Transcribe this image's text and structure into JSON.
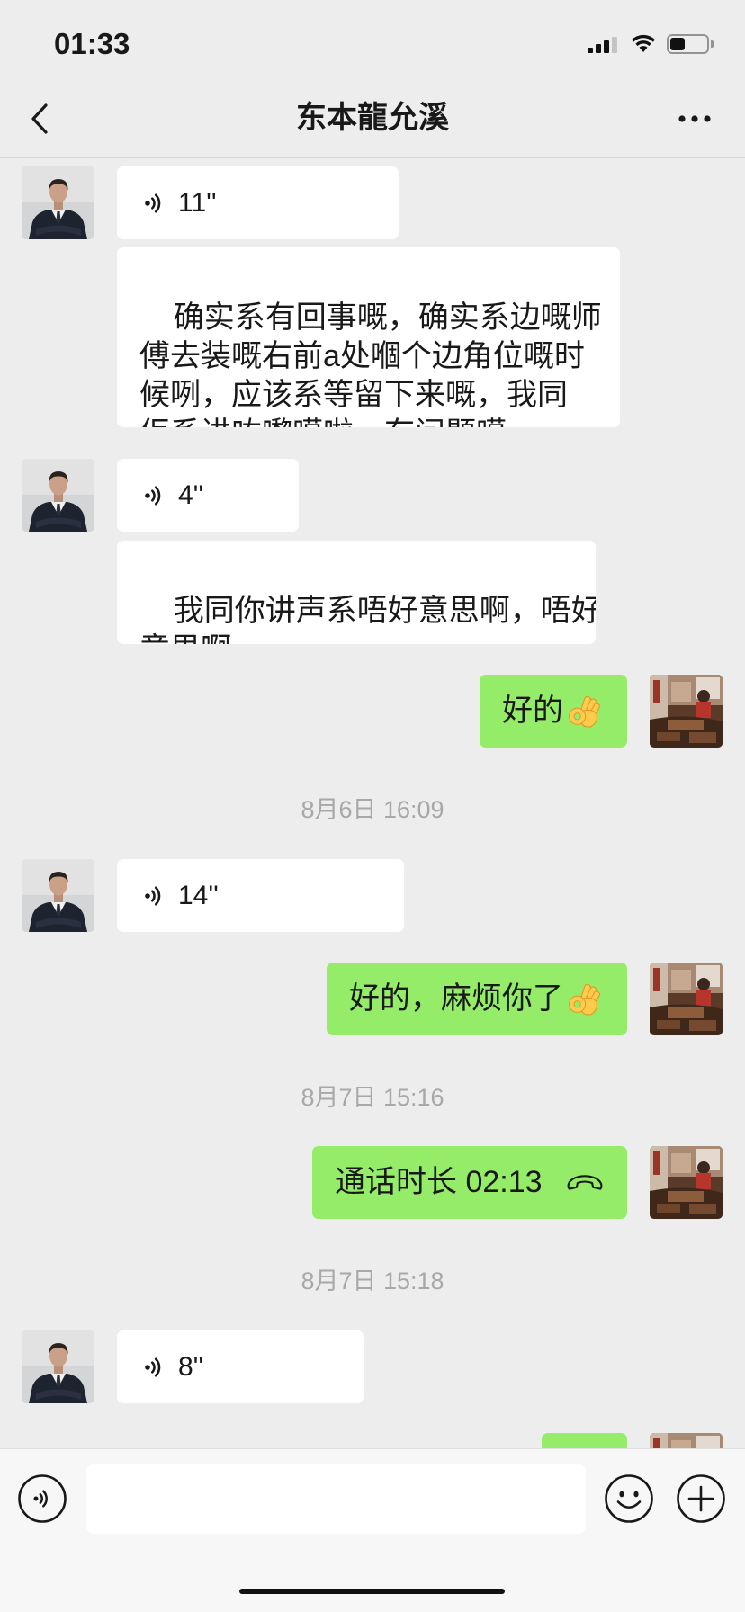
{
  "status_bar": {
    "time": "01:33",
    "signal_bars": 3,
    "battery_level": 0.4,
    "icons": [
      "signal-icon",
      "wifi-icon",
      "battery-icon"
    ]
  },
  "nav": {
    "title": "东本龍允溪",
    "back_icon": "chevron-left-icon",
    "more_icon": "more-dots-icon"
  },
  "messages": [
    {
      "side": "left",
      "type": "voice",
      "duration": "11''"
    },
    {
      "side": "left",
      "type": "voice_text",
      "text": "确实系有回事嘅，确实系边嘅师\n傅去装嘅右前a处嗰个边角位嘅时\n候咧，应该系等留下来嘅，我同\n佢系讲咗嚟噶啦，冇问题噶。"
    },
    {
      "side": "left",
      "type": "voice",
      "duration": "4''"
    },
    {
      "side": "left",
      "type": "voice_text",
      "text": "我同你讲声系唔好意思啊，唔好\n意思啊。"
    },
    {
      "side": "right",
      "type": "text",
      "text": "好的",
      "emoji": "ok-hand-emoji"
    },
    {
      "type": "timestamp",
      "text": "8月6日 16:09"
    },
    {
      "side": "left",
      "type": "voice",
      "duration": "14''"
    },
    {
      "side": "right",
      "type": "text",
      "text": "好的，麻烦你了",
      "emoji": "ok-hand-emoji"
    },
    {
      "type": "timestamp",
      "text": "8月7日 15:16"
    },
    {
      "side": "right",
      "type": "call",
      "text": "通话时长 02:13",
      "icon": "phone-hangup-icon"
    },
    {
      "type": "timestamp",
      "text": "8月7日 15:18"
    },
    {
      "side": "left",
      "type": "voice",
      "duration": "8''"
    },
    {
      "side": "right",
      "type": "text",
      "text": ""
    }
  ],
  "input_bar": {
    "value": "",
    "voice_icon": "voice-input-icon",
    "emoji_icon": "emoji-icon",
    "plus_icon": "plus-icon"
  },
  "colors": {
    "background": "#ededed",
    "incoming_bubble": "#ffffff",
    "outgoing_bubble": "#95ec69",
    "timestamp_text": "#a8a8a8",
    "input_bar": "#f7f7f7"
  }
}
